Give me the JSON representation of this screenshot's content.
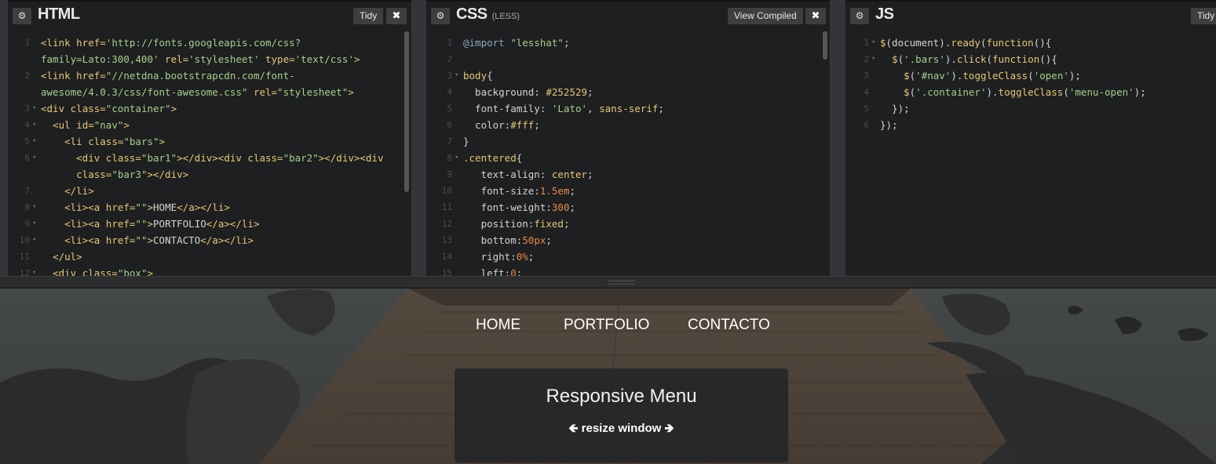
{
  "html_panel": {
    "title": "HTML",
    "tidy_label": "Tidy",
    "close_label": "✖",
    "lines": [
      {
        "num": "1",
        "fold": "",
        "segs": [
          [
            "t",
            "<link "
          ],
          [
            "a",
            "href="
          ],
          [
            "s",
            "'http://fonts.googleapis.com/css?"
          ]
        ]
      },
      {
        "num": "",
        "fold": "",
        "segs": [
          [
            "s",
            "family=Lato:300,400'"
          ],
          [
            "p",
            " "
          ],
          [
            "a",
            "rel="
          ],
          [
            "s",
            "'stylesheet'"
          ],
          [
            "p",
            " "
          ],
          [
            "a",
            "type="
          ],
          [
            "s",
            "'text/css'"
          ],
          [
            "t",
            ">"
          ]
        ]
      },
      {
        "num": "2",
        "fold": "",
        "segs": [
          [
            "t",
            "<link "
          ],
          [
            "a",
            "href="
          ],
          [
            "s",
            "\"//netdna.bootstrapcdn.com/font-"
          ]
        ]
      },
      {
        "num": "",
        "fold": "",
        "segs": [
          [
            "s",
            "awesome/4.0.3/css/font-awesome.css\""
          ],
          [
            "p",
            " "
          ],
          [
            "a",
            "rel="
          ],
          [
            "s",
            "\"stylesheet\""
          ],
          [
            "t",
            ">"
          ]
        ]
      },
      {
        "num": "3",
        "fold": "▾",
        "segs": [
          [
            "t",
            "<div "
          ],
          [
            "a",
            "class="
          ],
          [
            "s",
            "\"container\""
          ],
          [
            "t",
            ">"
          ]
        ]
      },
      {
        "num": "4",
        "fold": "▾",
        "segs": [
          [
            "p",
            "  "
          ],
          [
            "t",
            "<ul "
          ],
          [
            "a",
            "id="
          ],
          [
            "s",
            "\"nav\""
          ],
          [
            "t",
            ">"
          ]
        ]
      },
      {
        "num": "5",
        "fold": "▾",
        "segs": [
          [
            "p",
            "    "
          ],
          [
            "t",
            "<li "
          ],
          [
            "a",
            "class="
          ],
          [
            "s",
            "\"bars\""
          ],
          [
            "t",
            ">"
          ]
        ]
      },
      {
        "num": "6",
        "fold": "▾",
        "segs": [
          [
            "p",
            "      "
          ],
          [
            "t",
            "<div "
          ],
          [
            "a",
            "class="
          ],
          [
            "s",
            "\"bar1\""
          ],
          [
            "t",
            "></div><div "
          ],
          [
            "a",
            "class="
          ],
          [
            "s",
            "\"bar2\""
          ],
          [
            "t",
            "></div><div"
          ]
        ]
      },
      {
        "num": "",
        "fold": "",
        "segs": [
          [
            "p",
            "      "
          ],
          [
            "a",
            "class="
          ],
          [
            "s",
            "\"bar3\""
          ],
          [
            "t",
            "></div>"
          ]
        ]
      },
      {
        "num": "7",
        "fold": "",
        "segs": [
          [
            "p",
            "    "
          ],
          [
            "t",
            "</li>"
          ]
        ]
      },
      {
        "num": "8",
        "fold": "▾",
        "segs": [
          [
            "p",
            "    "
          ],
          [
            "t",
            "<li><a "
          ],
          [
            "a",
            "href="
          ],
          [
            "s",
            "\"\""
          ],
          [
            "t",
            ">"
          ],
          [
            "p",
            "HOME"
          ],
          [
            "t",
            "</a></li>"
          ]
        ]
      },
      {
        "num": "9",
        "fold": "▾",
        "segs": [
          [
            "p",
            "    "
          ],
          [
            "t",
            "<li><a "
          ],
          [
            "a",
            "href="
          ],
          [
            "s",
            "\"\""
          ],
          [
            "t",
            ">"
          ],
          [
            "p",
            "PORTFOLIO"
          ],
          [
            "t",
            "</a></li>"
          ]
        ]
      },
      {
        "num": "10",
        "fold": "▾",
        "segs": [
          [
            "p",
            "    "
          ],
          [
            "t",
            "<li><a "
          ],
          [
            "a",
            "href="
          ],
          [
            "s",
            "\"\""
          ],
          [
            "t",
            ">"
          ],
          [
            "p",
            "CONTACTO"
          ],
          [
            "t",
            "</a></li>"
          ]
        ]
      },
      {
        "num": "11",
        "fold": "",
        "segs": [
          [
            "p",
            "  "
          ],
          [
            "t",
            "</ul>"
          ]
        ]
      },
      {
        "num": "12",
        "fold": "▾",
        "segs": [
          [
            "p",
            "  "
          ],
          [
            "t",
            "<div "
          ],
          [
            "a",
            "class="
          ],
          [
            "s",
            "\"box\""
          ],
          [
            "t",
            ">"
          ]
        ]
      }
    ]
  },
  "css_panel": {
    "title": "CSS",
    "subtitle": "(LESS)",
    "view_compiled_label": "View Compiled",
    "close_label": "✖",
    "lines": [
      {
        "num": "1",
        "fold": "",
        "segs": [
          [
            "m",
            "@import"
          ],
          [
            "p",
            " "
          ],
          [
            "s",
            "\"lesshat\""
          ],
          [
            "p",
            ";"
          ]
        ]
      },
      {
        "num": "2",
        "fold": "",
        "segs": []
      },
      {
        "num": "3",
        "fold": "▾",
        "segs": [
          [
            "k",
            "body"
          ],
          [
            "p",
            "{"
          ]
        ]
      },
      {
        "num": "4",
        "fold": "",
        "segs": [
          [
            "p",
            "  background: "
          ],
          [
            "k",
            "#252529"
          ],
          [
            "p",
            ";"
          ]
        ]
      },
      {
        "num": "5",
        "fold": "",
        "segs": [
          [
            "p",
            "  font-family: "
          ],
          [
            "s",
            "'Lato'"
          ],
          [
            "p",
            ", "
          ],
          [
            "k",
            "sans-serif"
          ],
          [
            "p",
            ";"
          ]
        ]
      },
      {
        "num": "6",
        "fold": "",
        "segs": [
          [
            "p",
            "  color:"
          ],
          [
            "k",
            "#fff"
          ],
          [
            "p",
            ";"
          ]
        ]
      },
      {
        "num": "7",
        "fold": "",
        "segs": [
          [
            "p",
            "}"
          ]
        ]
      },
      {
        "num": "8",
        "fold": "▾",
        "segs": [
          [
            "k",
            ".centered"
          ],
          [
            "p",
            "{"
          ]
        ]
      },
      {
        "num": "9",
        "fold": "",
        "segs": [
          [
            "p",
            "   text-align: "
          ],
          [
            "k",
            "center"
          ],
          [
            "p",
            ";"
          ]
        ]
      },
      {
        "num": "10",
        "fold": "",
        "segs": [
          [
            "p",
            "   font-size:"
          ],
          [
            "n",
            "1.5em"
          ],
          [
            "p",
            ";"
          ]
        ]
      },
      {
        "num": "11",
        "fold": "",
        "segs": [
          [
            "p",
            "   font-weight:"
          ],
          [
            "n",
            "300"
          ],
          [
            "p",
            ";"
          ]
        ]
      },
      {
        "num": "12",
        "fold": "",
        "segs": [
          [
            "p",
            "   position:"
          ],
          [
            "k",
            "fixed"
          ],
          [
            "p",
            ";"
          ]
        ]
      },
      {
        "num": "13",
        "fold": "",
        "segs": [
          [
            "p",
            "   bottom:"
          ],
          [
            "n",
            "50px"
          ],
          [
            "p",
            ";"
          ]
        ]
      },
      {
        "num": "14",
        "fold": "",
        "segs": [
          [
            "p",
            "   right:"
          ],
          [
            "n",
            "0%"
          ],
          [
            "p",
            ";"
          ]
        ]
      },
      {
        "num": "15",
        "fold": "",
        "segs": [
          [
            "p",
            "   left:"
          ],
          [
            "n",
            "0"
          ],
          [
            "p",
            ";"
          ]
        ]
      }
    ]
  },
  "js_panel": {
    "title": "JS",
    "tidy_label": "Tidy",
    "lines": [
      {
        "num": "1",
        "fold": "▾",
        "segs": [
          [
            "f",
            "$"
          ],
          [
            "p",
            "(document)."
          ],
          [
            "f",
            "ready"
          ],
          [
            "p",
            "("
          ],
          [
            "f",
            "function"
          ],
          [
            "p",
            "(){"
          ]
        ]
      },
      {
        "num": "2",
        "fold": "▾",
        "segs": [
          [
            "p",
            "  "
          ],
          [
            "f",
            "$"
          ],
          [
            "p",
            "("
          ],
          [
            "s",
            "'.bars'"
          ],
          [
            "p",
            ")."
          ],
          [
            "f",
            "click"
          ],
          [
            "p",
            "("
          ],
          [
            "f",
            "function"
          ],
          [
            "p",
            "(){"
          ]
        ]
      },
      {
        "num": "3",
        "fold": "",
        "segs": [
          [
            "p",
            "    "
          ],
          [
            "f",
            "$"
          ],
          [
            "p",
            "("
          ],
          [
            "s",
            "'#nav'"
          ],
          [
            "p",
            ")."
          ],
          [
            "f",
            "toggleClass"
          ],
          [
            "p",
            "("
          ],
          [
            "s",
            "'open'"
          ],
          [
            "p",
            ");"
          ]
        ]
      },
      {
        "num": "4",
        "fold": "",
        "segs": [
          [
            "p",
            "    "
          ],
          [
            "f",
            "$"
          ],
          [
            "p",
            "("
          ],
          [
            "s",
            "'.container'"
          ],
          [
            "p",
            ")."
          ],
          [
            "f",
            "toggleClass"
          ],
          [
            "p",
            "("
          ],
          [
            "s",
            "'menu-open'"
          ],
          [
            "p",
            ");"
          ]
        ]
      },
      {
        "num": "5",
        "fold": "",
        "segs": [
          [
            "p",
            "  });"
          ]
        ]
      },
      {
        "num": "6",
        "fold": "",
        "segs": [
          [
            "p",
            "});"
          ]
        ]
      }
    ]
  },
  "preview": {
    "nav": [
      "HOME",
      "PORTFOLIO",
      "CONTACTO"
    ],
    "box_title": "Responsive Menu",
    "box_sub": "resize window",
    "left_arrow": "🡸",
    "right_arrow": "🡺"
  }
}
